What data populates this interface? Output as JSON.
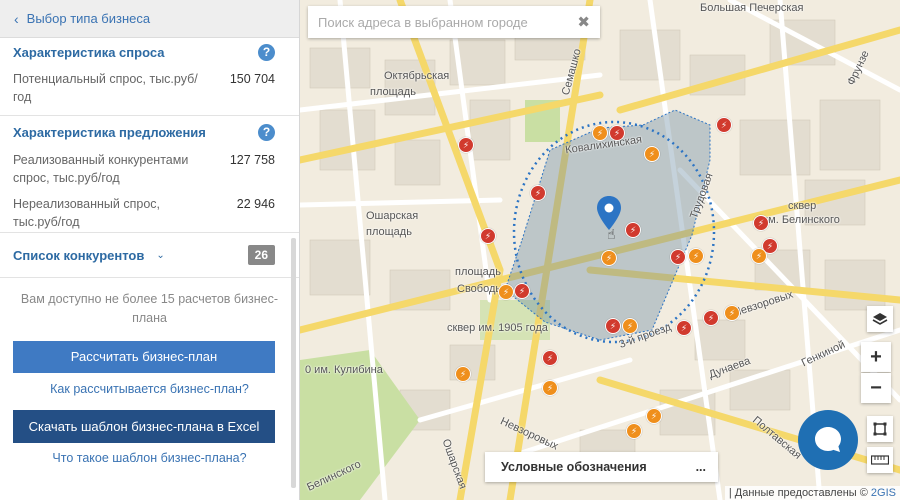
{
  "sidebar": {
    "back_label": "Выбор типа бизнеса",
    "demand": {
      "title": "Характеристика спроса",
      "rows": [
        {
          "label": "Потенциальный спрос, тыс.руб/год",
          "value": "150 704"
        }
      ]
    },
    "supply": {
      "title": "Характеристика предложения",
      "rows": [
        {
          "label": "Реализованный конкурентами спрос, тыс.руб/год",
          "value": "127 758"
        },
        {
          "label": "Нереализованный спрос, тыс.руб/год",
          "value": "22 946"
        }
      ]
    },
    "competitors": {
      "title": "Список конкурентов",
      "count": "26"
    },
    "limit_note": "Вам доступно не более 15 расчетов бизнес-плана",
    "calc_button": "Рассчитать бизнес-план",
    "calc_link": "Как рассчитывается бизнес-план?",
    "download_button": "Скачать шаблон бизнес-плана в Excel",
    "template_link": "Что такое шаблон бизнес-плана?"
  },
  "map": {
    "search_placeholder": "Поиск адреса в выбранном городе",
    "labels": {
      "bolshaya_pecherskaya": "Большая Печерская",
      "oktyabrskaya": "Октябрьская",
      "ploshad1": "площадь",
      "semashko": "Семашко",
      "kovalikhinskaya": "Ковалихинская",
      "trudovaya": "Трудовая",
      "skver": "сквер",
      "belinskogo": "им. Белинского",
      "osharskaya": "Ошарская",
      "ploshad2": "площадь",
      "ploshad3": "площадь",
      "svobody": "Свободы",
      "skver1905": "сквер им. 1905 года",
      "proezd3": "3-й проезд",
      "nevzorovykh1": "Невзоровых",
      "kulibina": "0 им. Кулибина",
      "dunaeva": "Дунаева",
      "genkinoi": "Генкиной",
      "nevzorovykh2": "Невзоровых",
      "poltavskaya": "Полтавская",
      "osharskaya2": "Ошарская",
      "belinskogo_street": "Белинского",
      "fruktovaya": "Фрунзе"
    },
    "legend_label": "Условные обозначения",
    "legend_more": "...",
    "attribution_prefix": "| Данные предоставлены ©",
    "attribution_brand": "2GIS",
    "zoom_in": "+",
    "zoom_out": "−",
    "colors": {
      "competitor_red": "#d13a2e",
      "competitor_orange": "#ef8f1c",
      "pin": "#2c74c4",
      "zone_fill": "#6f8ea6"
    }
  }
}
